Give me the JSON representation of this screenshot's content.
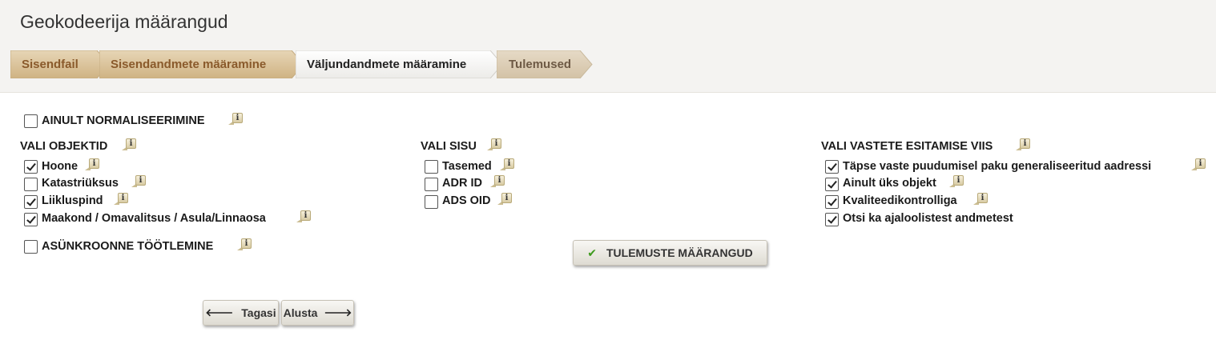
{
  "page": {
    "title": "Geokodeerija määrangud"
  },
  "steps": [
    {
      "label": "Sisendfail",
      "state": "done"
    },
    {
      "label": "Sisendandmete määramine",
      "state": "done"
    },
    {
      "label": "Väljundandmete määramine",
      "state": "active"
    },
    {
      "label": "Tulemused",
      "state": "future"
    }
  ],
  "options": {
    "normalize_only": {
      "label": "AINULT NORMALISEERIMINE",
      "checked": false
    },
    "async_processing": {
      "label": "ASÜNKROONNE TÖÖTLEMINE",
      "checked": false
    }
  },
  "objects": {
    "title": "VALI OBJEKTID",
    "items": [
      {
        "label": "Hoone",
        "checked": true
      },
      {
        "label": "Katastriüksus",
        "checked": false
      },
      {
        "label": "Liikluspind",
        "checked": true
      },
      {
        "label": "Maakond / Omavalitsus / Asula/Linnaosa",
        "checked": true
      }
    ]
  },
  "content": {
    "title": "VALI SISU",
    "items": [
      {
        "label": "Tasemed",
        "checked": false
      },
      {
        "label": "ADR ID",
        "checked": false
      },
      {
        "label": "ADS OID",
        "checked": false
      }
    ]
  },
  "presentation": {
    "title": "VALI VASTETE ESITAMISE VIIS",
    "items": [
      {
        "label": "Täpse vaste puudumisel paku generaliseeritud aadressi",
        "checked": true
      },
      {
        "label": "Ainult üks objekt",
        "checked": true
      },
      {
        "label": "Kvaliteedikontrolliga",
        "checked": true
      },
      {
        "label": "Otsi ka ajaloolistest andmetest",
        "checked": true
      }
    ]
  },
  "buttons": {
    "results_settings": "TULEMUSTE MÄÄRANGUD",
    "back": "Tagasi",
    "start": "Alusta"
  },
  "icons": {
    "info": "i",
    "check": "✔",
    "arrow_left": "🡐",
    "arrow_right": "🡒"
  },
  "colors": {
    "step_done_fill": "#d9c29a",
    "step_active_fill": "#f7f7f7",
    "step_future_fill": "#dccfba",
    "step_done_text": "#8a5a2b",
    "accent_green": "#3c9a1c"
  }
}
